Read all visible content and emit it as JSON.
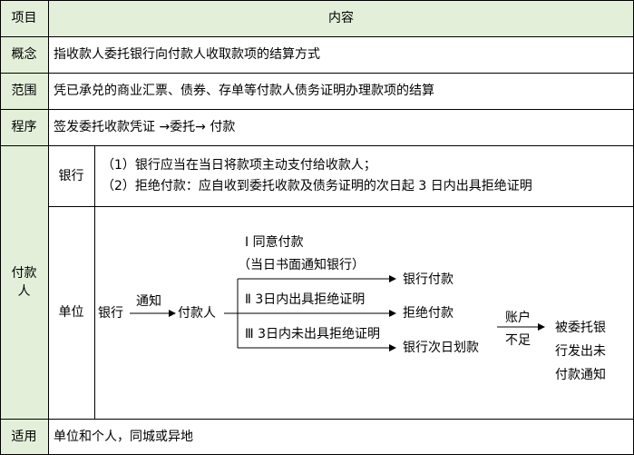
{
  "header": {
    "item": "项目",
    "content": "内容"
  },
  "rows": {
    "concept": {
      "label": "概念",
      "text": "指收款人委托银行向付款人收取款项的结算方式"
    },
    "scope": {
      "label": "范围",
      "text": "凭已承兑的商业汇票、债券、存单等付款人债务证明办理款项的结算"
    },
    "procedure": {
      "label": "程序",
      "text": "签发委托收款凭证 →委托→ 付款"
    },
    "payer": {
      "label_line1": "付款",
      "label_line2": "人",
      "bank": {
        "label": "银行",
        "line1": "（1）银行应当在当日将款项主动支付给收款人；",
        "line2": "（2）拒绝付款：应自收到委托收款及债务证明的次日起 3 日内出具拒绝证明"
      },
      "unit": {
        "label": "单位",
        "flow": {
          "bank": "银行",
          "notify": "通知",
          "payer": "付款人",
          "opt1_title": "Ⅰ 同意付款",
          "opt1_note": "（当日书面通知银行）",
          "opt2_title": "Ⅱ  3日内出具拒绝证明",
          "opt3_title": "Ⅲ  3日内未出具拒绝证明",
          "result1": "银行付款",
          "result2": "拒绝付款",
          "result3": "银行次日划款",
          "account_top": "账户",
          "account_bottom": "不足",
          "final_line1": "被委托银",
          "final_line2": "行发出未",
          "final_line3": "付款通知"
        }
      }
    },
    "applicable": {
      "label": "适用",
      "text": "单位和个人，同城或异地"
    }
  }
}
